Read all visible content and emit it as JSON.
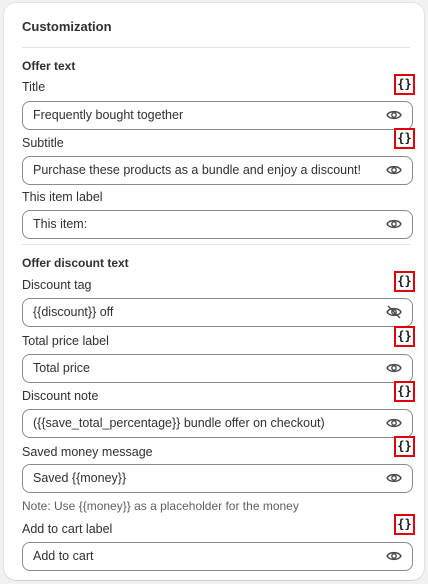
{
  "card": {
    "title": "Customization"
  },
  "offer_text": {
    "heading": "Offer text",
    "title_label": "Title",
    "title_value": "Frequently bought together",
    "subtitle_label": "Subtitle",
    "subtitle_value": "Purchase these products as a bundle and enjoy a discount!",
    "item_label_label": "This item label",
    "item_label_value": "This item:"
  },
  "offer_discount_text": {
    "heading": "Offer discount text",
    "discount_tag_label": "Discount tag",
    "discount_tag_value": "{{discount}} off",
    "total_price_label": "Total price label",
    "total_price_value": "Total price",
    "discount_note_label": "Discount note",
    "discount_note_value": "({{save_total_percentage}} bundle offer on checkout)",
    "saved_money_label": "Saved money message",
    "saved_money_value": "Saved {{money}}",
    "saved_money_note": "Note: Use {{money}} as a placeholder for the money",
    "add_to_cart_label": "Add to cart label",
    "add_to_cart_value": "Add to cart"
  },
  "variable_button_glyph": "{}",
  "icons": {
    "visible": "eye-icon",
    "hidden": "eye-off-icon"
  },
  "colors": {
    "highlight": "#e0000a",
    "border": "#8a8a8a",
    "background": "#f1f1f1"
  }
}
